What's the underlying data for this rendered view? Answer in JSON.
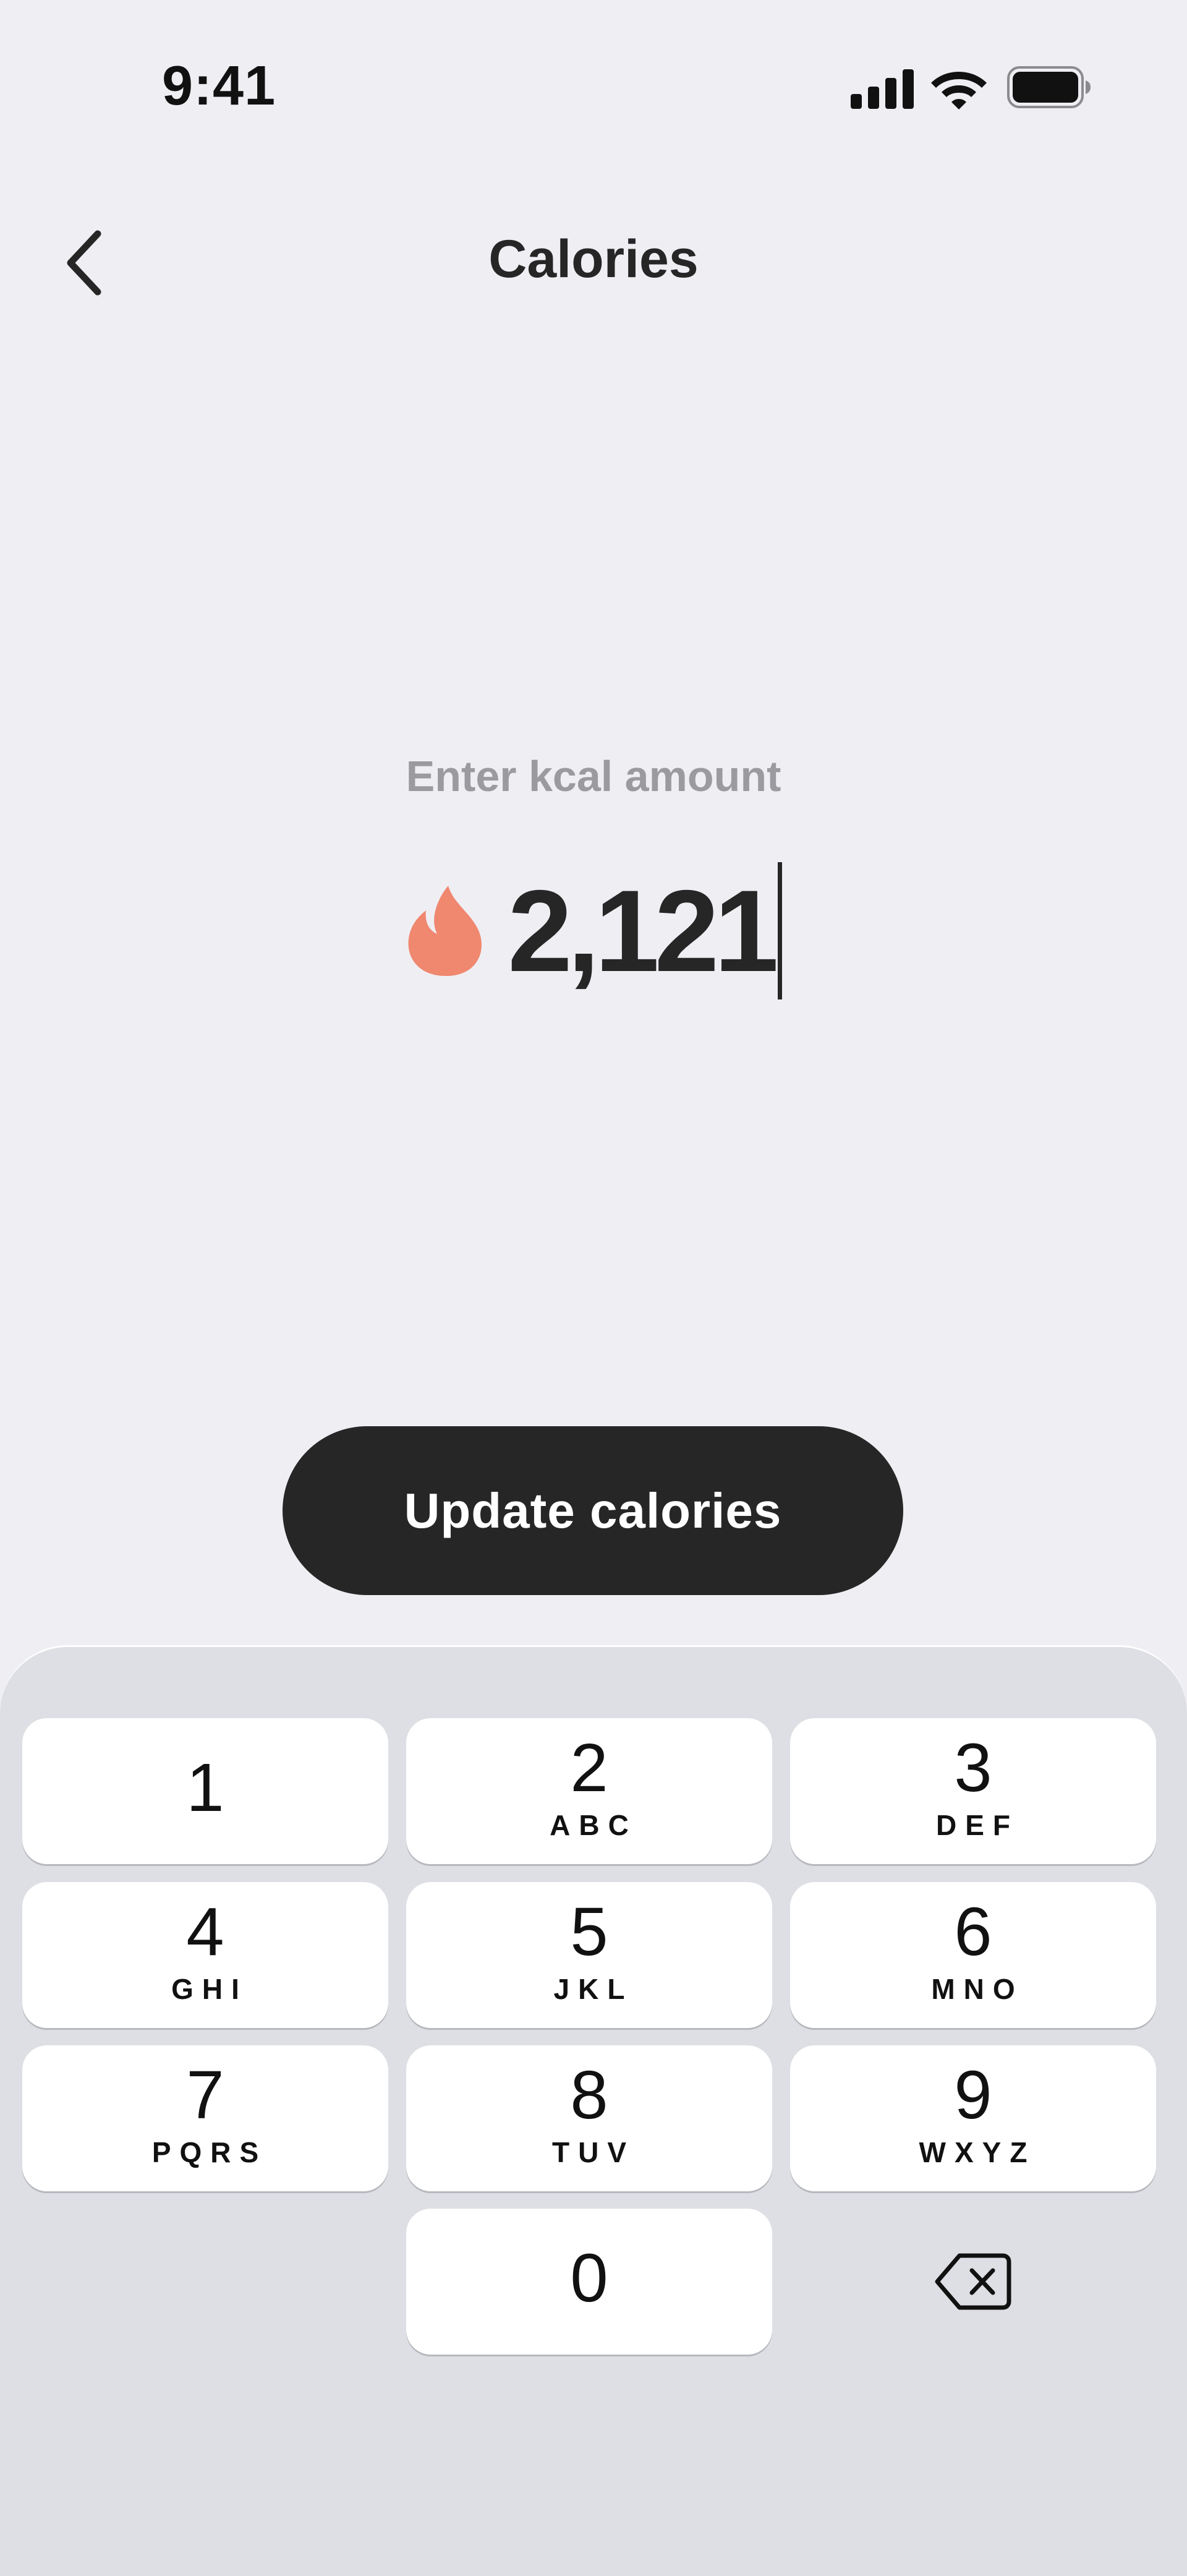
{
  "status_bar": {
    "time": "9:41",
    "icons": [
      "cellular-signal-icon",
      "wifi-icon",
      "battery-icon"
    ]
  },
  "nav": {
    "back_icon": "chevron-left-icon",
    "title": "Calories"
  },
  "entry": {
    "label": "Enter kcal amount",
    "icon": "flame-icon",
    "value": "2,121"
  },
  "update_button": {
    "label": "Update calories"
  },
  "keypad": {
    "keys": [
      {
        "digit": "1",
        "letters": ""
      },
      {
        "digit": "2",
        "letters": "ABC"
      },
      {
        "digit": "3",
        "letters": "DEF"
      },
      {
        "digit": "4",
        "letters": "GHI"
      },
      {
        "digit": "5",
        "letters": "JKL"
      },
      {
        "digit": "6",
        "letters": "MNO"
      },
      {
        "digit": "7",
        "letters": "PQRS"
      },
      {
        "digit": "8",
        "letters": "TUV"
      },
      {
        "digit": "9",
        "letters": "WXYZ"
      },
      {
        "digit": "0",
        "letters": ""
      }
    ],
    "delete_icon": "backspace-icon"
  },
  "colors": {
    "background": "#EFEEF3",
    "accent_flame": "#F0876F",
    "button": "#262626",
    "keypad_bg": "#DEDFE4"
  }
}
